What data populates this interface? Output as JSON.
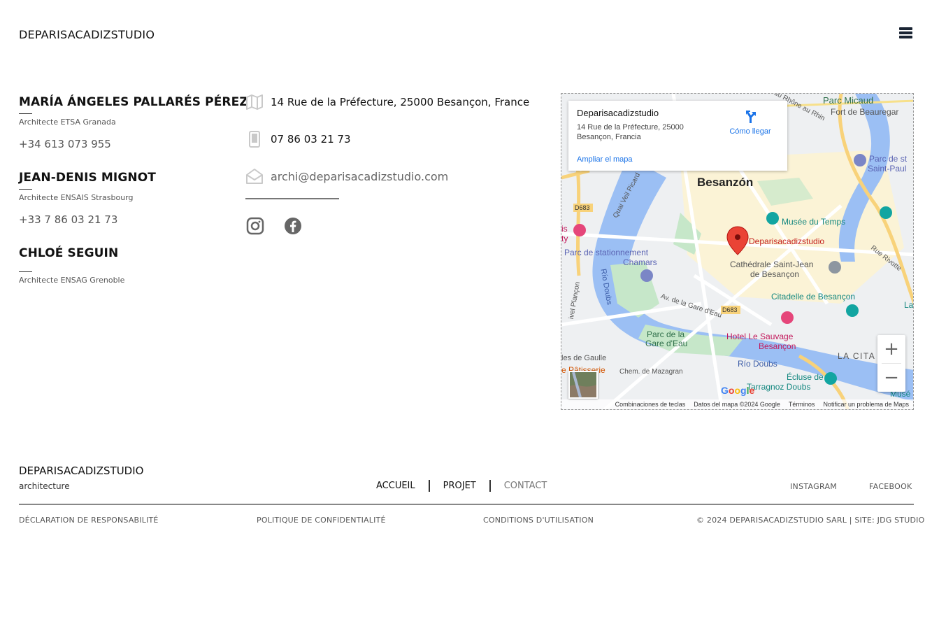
{
  "header": {
    "brand": "DEPARISACADIZSTUDIO",
    "menu_icon": "hamburger-menu-icon"
  },
  "people": [
    {
      "name": "MARÍA ÁNGELES PALLARÉS PÉREZ",
      "title": "Architecte ETSA Granada",
      "phone": "+34 613 073 955"
    },
    {
      "name": "JEAN-DENIS MIGNOT",
      "title": "Architecte ENSAIS Strasbourg",
      "phone": "+33 7 86 03 21 73"
    },
    {
      "name": "CHLOÉ SEGUIN",
      "title": "Architecte ENSAG Grenoble",
      "phone": ""
    }
  ],
  "contact": {
    "address": "14 Rue de la Préfecture, 25000 Besançon, France",
    "phone": "07 86 03 21 73",
    "email": "archi@deparisacadizstudio.com",
    "address_icon": "map-icon",
    "phone_icon": "phone-icon",
    "email_icon": "envelope-icon",
    "social_icons": [
      "instagram-icon",
      "facebook-icon"
    ]
  },
  "map": {
    "place_name": "Deparisacadizstudio",
    "place_address": "14 Rue de la Préfecture, 25000 Besançon, Francia",
    "directions_label": "Cómo llegar",
    "enlarge_label": "Ampliar el mapa",
    "city_label": "Besanzón",
    "pin_label": "Deparisacadizstudio",
    "labels": {
      "parc_micaud": "Parc Micaud",
      "fort": "Fort de Beauregar",
      "parc_st": "Parc de st",
      "saint_paul": "Saint-Paul",
      "musee": "Musée du Temps",
      "parc_stationnement": "Parc de stationnement",
      "chamars": "Chamars",
      "cathedrale_1": "Cathédrale Saint-Jean",
      "cathedrale_2": "de Besançon",
      "citadelle": "Citadelle de Besançon",
      "rio_doubs_1": "Río Doubs",
      "rio_doubs_2": "Río Doubs",
      "parc_gare_1": "Parc de la",
      "parc_gare_2": "Gare d'Eau",
      "hotel_1": "Hotel Le Sauvage",
      "hotel_2": "Besançon",
      "citadelle_short": "LA CITA",
      "ecluse_1": "Écluse de",
      "ecluse_2": "Tarragnoz Doubs",
      "patisserie": "e Pâtisserie",
      "mazagran": "Chem. de Mazagran",
      "gare_eau_road": "Av. de la Gare d'Eau",
      "quai": "Quai Veil Picard",
      "rue_rivotte": "Rue Rivotte",
      "d683_a": "D683",
      "d683_b": "D683",
      "de_gaulle": "les de Gaulle",
      "plancon": "ivel Plançon",
      "musee_short": "Musé",
      "la": "La",
      "ty": "ty",
      "is": "is",
      "au_rhin": "du Rhône au Rhin"
    },
    "zoom_in": "+",
    "zoom_out": "−",
    "footer": [
      "Combinaciones de teclas",
      "Datos del mapa ©2024 Google",
      "Términos",
      "Notificar un problema de Maps"
    ],
    "google": "Google"
  },
  "footer": {
    "brand": "DEPARISACADIZSTUDIO",
    "subtitle": "architecture",
    "nav": [
      "ACCUEIL",
      "PROJET",
      "CONTACT"
    ],
    "instagram": "INSTAGRAM",
    "facebook": "FACEBOOK",
    "legal": {
      "disclaimer": "DÉCLARATION DE RESPONSABILITÉ",
      "privacy": "POLITIQUE DE CONFIDENTIALITÉ",
      "terms": "CONDITIONS D'UTILISATION",
      "copyright": "© 2024 DEPARISACADIZSTUDIO SARL | SITE: JDG STUDIO"
    }
  },
  "colors": {
    "water": "#9bbff4",
    "park": "#c6e7c9",
    "road_major": "#f8d27a",
    "urban": "#fbf3d6",
    "pin": "#ea4335",
    "link": "#1a73e8",
    "poi_teal": "#12a5a1",
    "poi_pink": "#e5467a"
  }
}
